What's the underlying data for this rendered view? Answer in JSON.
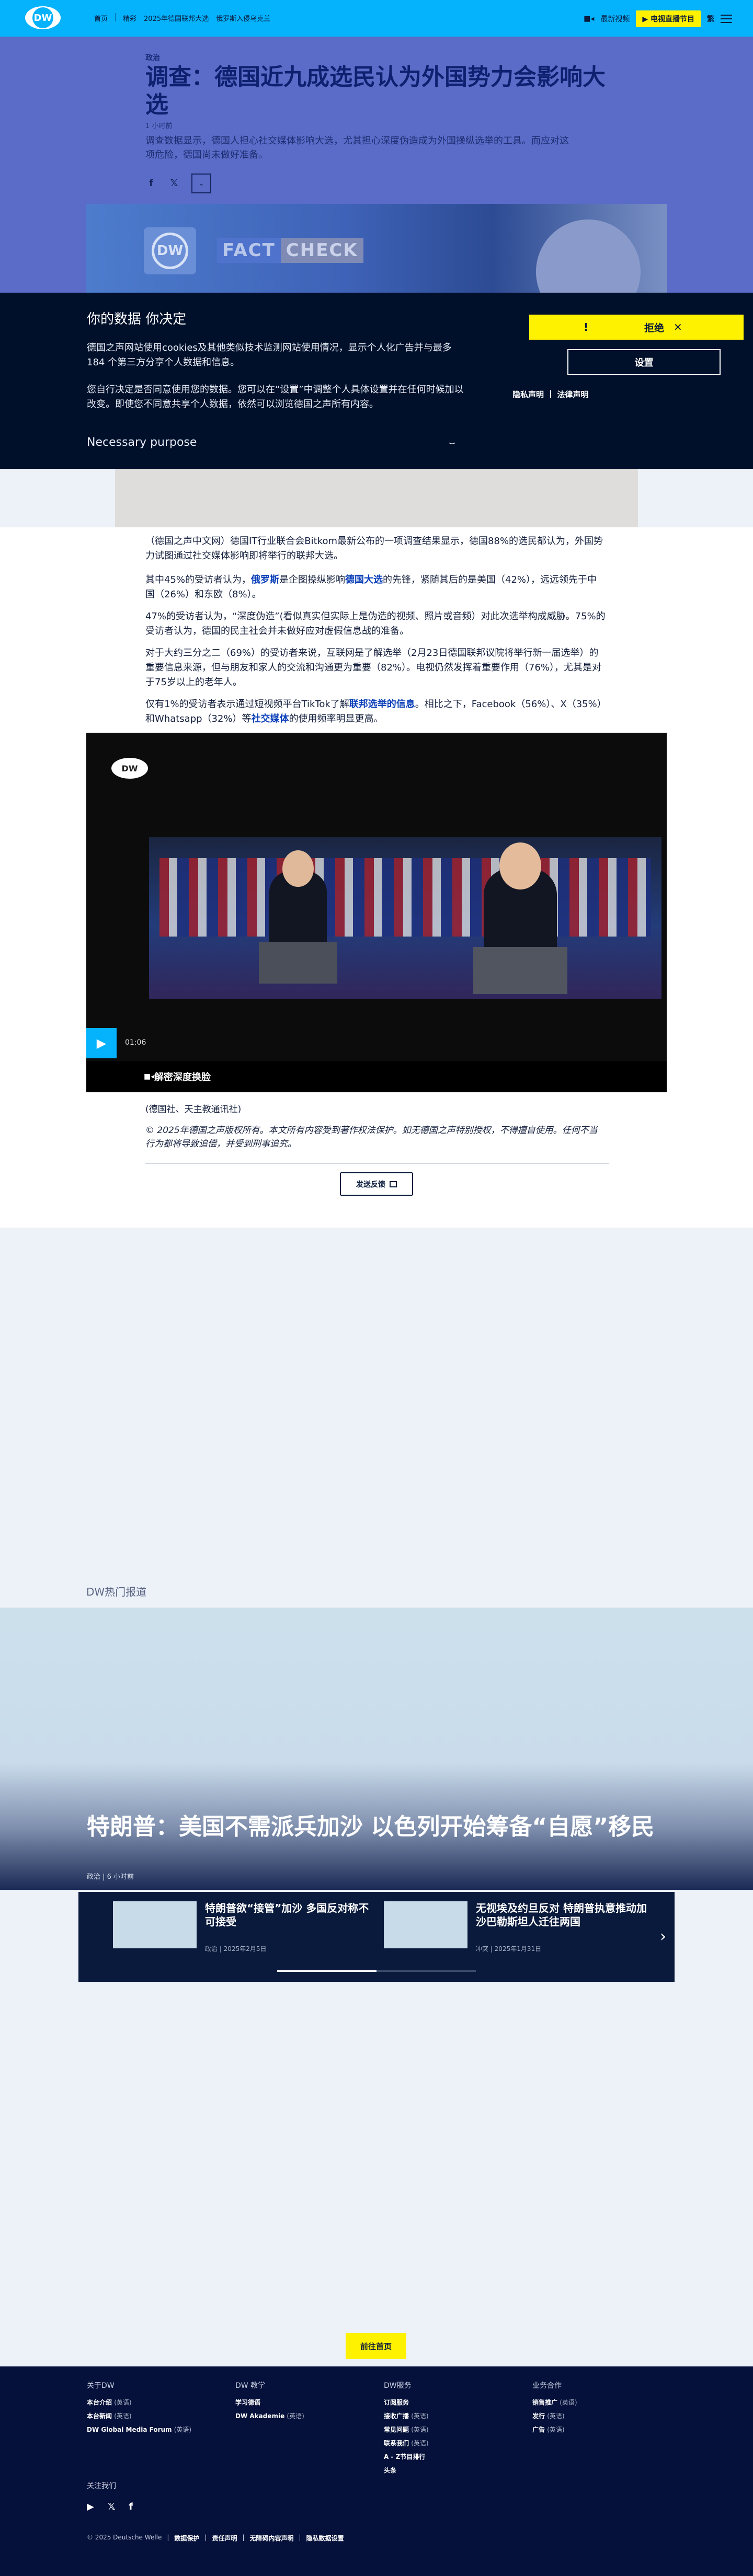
{
  "header": {
    "logo_text": "DW",
    "nav": [
      "首页",
      "精彩",
      "2025年德国联邦大选",
      "俄罗斯入侵乌克兰"
    ],
    "live_video": "最新视频",
    "live_tv": "电视直播节目",
    "lang": "繁"
  },
  "article": {
    "kicker": "政治",
    "headline": "调查：德国近九成选民认为外国势力会影响大选",
    "time": "1 小时前",
    "lead": "调查数据显示，德国人担心社交媒体影响大选，尤其担心深度伪造成为外国操纵选举的工具。而应对这项危险，德国尚未做好准备。",
    "hero_fc1": "FACT",
    "hero_fc2": "CHECK",
    "hero_logo": "DW",
    "p1": "（德国之声中文网）德国IT行业联合会Bitkom最新公布的一项调查结果显示，德国88%的选民都认为，外国势力试图通过社交媒体影响即将举行的联邦大选。",
    "p2_a": "其中45%的受访者认为，",
    "p2_link1": "俄罗斯",
    "p2_b": "是企图操纵影响",
    "p2_link2": "德国大选",
    "p2_c": "的先锋，紧随其后的是美国（42%），远远领先于中国（26%）和东欧（8%）。",
    "p3": "47%的受访者认为，“深度伪造”(看似真实但实际上是伪造的视频、照片或音频）对此次选举构成威胁。75%的受访者认为，德国的民主社会并未做好应对虚假信息战的准备。",
    "p4": "对于大约三分之二（69%）的受访者来说，互联网是了解选举（2月23日德国联邦议院将举行新一届选举）的重要信息来源，但与朋友和家人的交流和沟通更为重要（82%）。电视仍然发挥着重要作用（76%），尤其是对于75岁以上的老年人。",
    "p5_a": "仅有1%的受访者表示通过短视频平台TikTok了解",
    "p5_link1": "联邦选举的信息",
    "p5_b": "。相比之下，Facebook（56%）、X（35%）和Whatsapp（32%）等",
    "p5_link2": "社交媒体",
    "p5_c": "的使用频率明显更高。",
    "video_logo": "DW",
    "video_duration": "01:06",
    "video_caption": "解密深度换脸",
    "credit": "(德国社、天主教通讯社)",
    "copyright": "© 2025年德国之声版权所有。本文所有内容受到著作权法保护。如无德国之声特别授权，不得擅自使用。任何不当行为都将导致追偿，并受到刑事追究。",
    "feedback": "发送反馈"
  },
  "cookie": {
    "title": "你的数据 你决定",
    "p1": "德国之声网站使用cookies及其他类似技术监测网站使用情况，显示个人化广告并与最多184 个第三方分享个人数据和信息。",
    "p2": "您自行决定是否同意使用您的数据。您可以在“设置”中调整个人具体设置并在任何时候加以改变。即使您不同意共享个人数据，依然可以浏览德国之声所有内容。",
    "purpose": "Necessary purpose",
    "reject": "拒绝",
    "settings": "设置",
    "privacy": "隐私声明",
    "legal": "法律声明"
  },
  "popular": {
    "section_title": "DW热门报道",
    "headline": "特朗普：美国不需派兵加沙 以色列开始筹备“自愿”移民",
    "meta": "政治 | 6 小时前",
    "teasers": [
      {
        "title": "特朗普欲“接管”加沙 多国反对称不可接受",
        "meta": "政治 | 2025年2月5日"
      },
      {
        "title": "无视埃及约旦反对 特朗普执意推动加沙巴勒斯坦人迁往两国",
        "meta": "冲突 | 2025年1月31日"
      }
    ],
    "home_button": "前往首页"
  },
  "footer": {
    "col1": {
      "title": "关于DW",
      "items": [
        [
          "本台介绍",
          "(英语)"
        ],
        [
          "本台新闻",
          "(英语)"
        ],
        [
          "DW Global Media Forum",
          "(英语)"
        ]
      ]
    },
    "col2": {
      "title": "DW 教学",
      "items": [
        [
          "学习德语",
          ""
        ],
        [
          "DW Akademie",
          "(英语)"
        ]
      ]
    },
    "col3": {
      "title": "DW服务",
      "items": [
        [
          "订阅服务",
          ""
        ],
        [
          "接收广播",
          "(英语)"
        ],
        [
          "常见问题",
          "(英语)"
        ],
        [
          "联系我们",
          "(英语)"
        ],
        [
          "A - Z节目排行",
          ""
        ],
        [
          "头条",
          ""
        ]
      ]
    },
    "col4": {
      "title": "业务合作",
      "items": [
        [
          "销售推广",
          "(英语)"
        ],
        [
          "发行",
          "(英语)"
        ],
        [
          "广告",
          "(英语)"
        ]
      ]
    },
    "follow": "关注我们",
    "legal": [
      "© 2025 Deutsche Welle",
      "数据保护",
      "责任声明",
      "无障碍内容声明",
      "隐私数据设置"
    ]
  }
}
